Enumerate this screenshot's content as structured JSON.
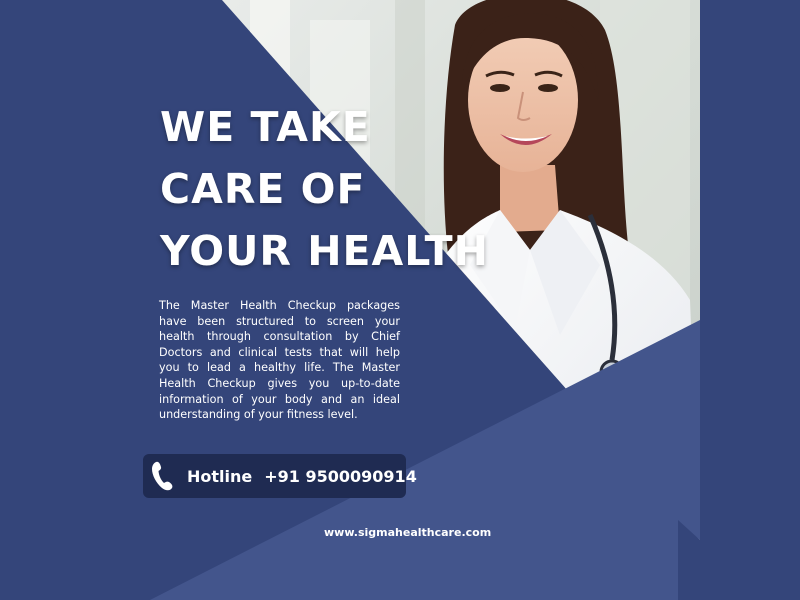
{
  "headline": [
    "WE TAKE",
    "CARE OF",
    "YOUR HEALTH"
  ],
  "description": "The Master Health Checkup packages have been structured to screen your health through consultation by Chief Doctors and clinical tests that will help you to lead a healthy life. The Master Health Checkup gives you up-to-date information of your body and an ideal understanding of your fitness level.",
  "hotline": {
    "label": "Hotline",
    "number": "+91 9500090914",
    "icon": "phone-icon"
  },
  "website": "www.sigmahealthcare.com",
  "colors": {
    "background_dark": "#34457a",
    "background_light": "#43558c",
    "hotline_box": "#1f2b52",
    "text": "#ffffff"
  }
}
